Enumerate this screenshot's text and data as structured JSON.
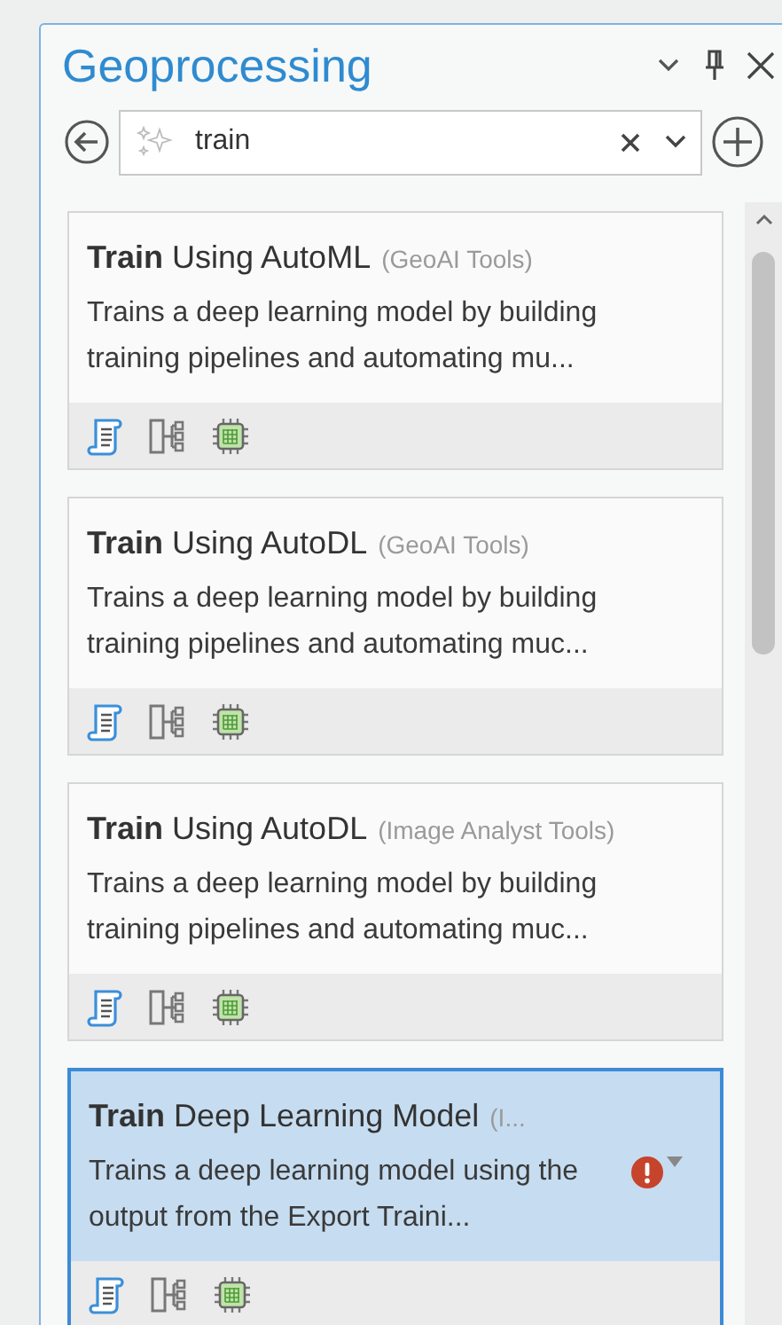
{
  "pane": {
    "title": "Geoprocessing"
  },
  "search": {
    "value": "train"
  },
  "results": [
    {
      "title": "**Train** Using AutoML",
      "source": "(GeoAI Tools)",
      "description": "Trains a deep learning model by building training pipelines and automating mu...",
      "selected": false,
      "error": false
    },
    {
      "title": "**Train** Using AutoDL",
      "source": "(GeoAI Tools)",
      "description": "Trains a deep learning model by building training pipelines and automating muc...",
      "selected": false,
      "error": false
    },
    {
      "title": "**Train** Using AutoDL",
      "source": "(Image Analyst Tools)",
      "description": "Trains a deep learning model by building training pipelines and automating muc...",
      "selected": false,
      "error": false
    },
    {
      "title": "**Train** Deep Learning Model",
      "source": "(I...",
      "description": "Trains a deep learning model using the output from the Export Traini...",
      "selected": true,
      "error": true
    }
  ]
}
